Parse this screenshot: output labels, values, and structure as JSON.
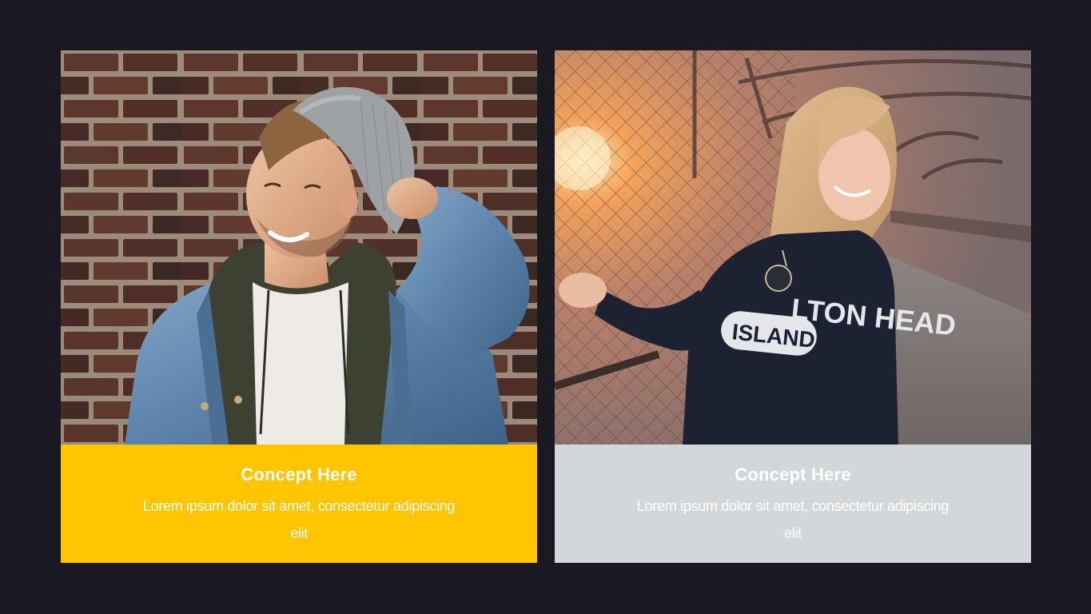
{
  "slide": {
    "background_color": "#1a1922"
  },
  "cards": [
    {
      "image_subject": "smiling young man in grey beanie and denim jacket against brick wall",
      "title": "Concept Here",
      "body": "Lorem ipsum dolor sit amet, consectetur adipiscing elit",
      "caption_color": "#ffc500"
    },
    {
      "image_subject": "young woman with long blonde hair wearing navy sweatshirt on a fenced bridge at sunset",
      "sweatshirt_text_line1": "LTON HEAD",
      "sweatshirt_text_line2": "ISLAND",
      "title": "Concept Here",
      "body": "Lorem ipsum dolor sit amet, consectetur adipiscing elit",
      "caption_color": "#d4d7da"
    }
  ]
}
